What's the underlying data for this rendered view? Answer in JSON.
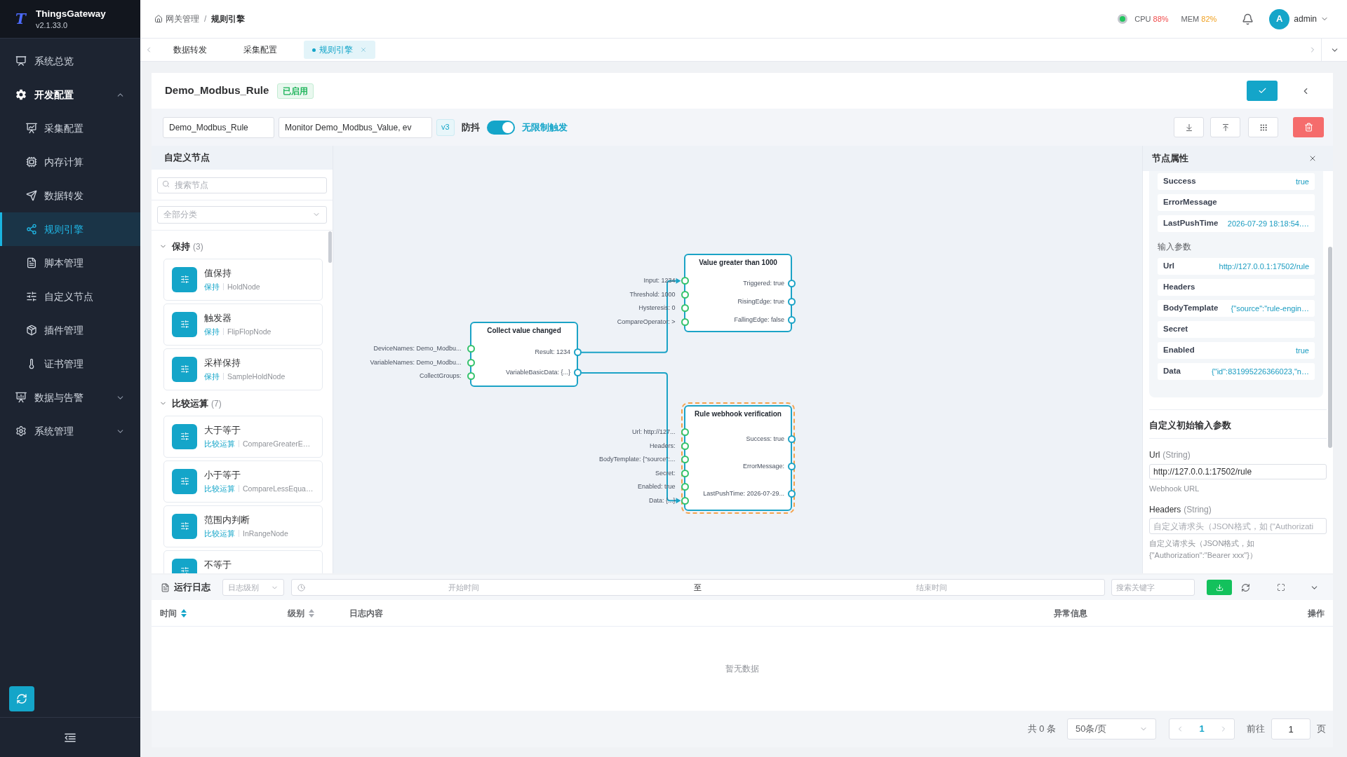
{
  "app": {
    "logo": "T",
    "name": "ThingsGateway",
    "version": "v2.1.33.0"
  },
  "sidebar": {
    "items": [
      {
        "label": "系统总览",
        "selected": false
      },
      {
        "label": "开发配置",
        "selected": false,
        "expanded": true,
        "children": [
          {
            "label": "采集配置",
            "selected": false
          },
          {
            "label": "内存计算",
            "selected": false
          },
          {
            "label": "数据转发",
            "selected": false
          },
          {
            "label": "规则引擎",
            "selected": true
          },
          {
            "label": "脚本管理",
            "selected": false
          },
          {
            "label": "自定义节点",
            "selected": false
          },
          {
            "label": "插件管理",
            "selected": false
          },
          {
            "label": "证书管理",
            "selected": false
          }
        ]
      },
      {
        "label": "数据与告警",
        "selected": false,
        "expanded": false
      },
      {
        "label": "系统管理",
        "selected": false,
        "expanded": false
      }
    ]
  },
  "header": {
    "breadcrumb": {
      "items": [
        "网关管理",
        "规则引擎"
      ],
      "separator": "/"
    },
    "online": true,
    "metrics": [
      {
        "label": "CPU",
        "value": "88%",
        "color": "#f04b4b"
      },
      {
        "label": "MEM",
        "value": "82%",
        "color": "#f0a020"
      }
    ],
    "user": {
      "initial": "A",
      "name": "admin"
    }
  },
  "tabs": [
    {
      "label": "数据转发",
      "selected": false
    },
    {
      "label": "采集配置",
      "selected": false
    },
    {
      "label": "规则引擎",
      "selected": true
    }
  ],
  "rule": {
    "title": "Demo_Modbus_Rule",
    "status": {
      "label": "已启用",
      "enabled": true
    },
    "name": "Demo_Modbus_Rule",
    "description": "Monitor Demo_Modbus_Value, ev",
    "version": "v3",
    "trigger_switch": {
      "off_label": "防抖",
      "on_label": "无限制触发",
      "on": true
    }
  },
  "node_library": {
    "title": "自定义节点",
    "search": {
      "placeholder": "搜索节点"
    },
    "category": {
      "placeholder": "全部分类"
    },
    "groups": [
      {
        "name": "保持",
        "count": "(3)",
        "expanded": true,
        "children": [
          {
            "title": "值保持",
            "category": "保持",
            "type": "HoldNode"
          },
          {
            "title": "触发器",
            "category": "保持",
            "type": "FlipFlopNode"
          },
          {
            "title": "采样保持",
            "category": "保持",
            "type": "SampleHoldNode"
          }
        ]
      },
      {
        "name": "比较运算",
        "count": "(7)",
        "expanded": true,
        "children": [
          {
            "title": "大于等于",
            "category": "比较运算",
            "type": "CompareGreaterE…"
          },
          {
            "title": "小于等于",
            "category": "比较运算",
            "type": "CompareLessEqua…"
          },
          {
            "title": "范围内判断",
            "category": "比较运算",
            "type": "InRangeNode"
          },
          {
            "title": "不等于"
          }
        ]
      }
    ]
  },
  "canvas": {
    "nodes": [
      {
        "title": "Collect value changed",
        "selected": false,
        "inputs": [
          "DeviceNames: Demo_Modbu...",
          "VariableNames: Demo_Modbu...",
          "CollectGroups:"
        ],
        "outputs": [
          "Result: 1234",
          "VariableBasicData: {...}"
        ]
      },
      {
        "title": "Value greater than 1000",
        "selected": false,
        "inputs": [
          "Input: 1234",
          "Threshold: 1000",
          "Hysteresis: 0",
          "CompareOperator: >"
        ],
        "outputs": [
          "Triggered: true",
          "RisingEdge: true",
          "FallingEdge: false"
        ]
      },
      {
        "title": "Rule webhook verification",
        "selected": true,
        "inputs": [
          "Url: http://127...",
          "Headers:",
          "BodyTemplate: {\"source\":...",
          "Secret:",
          "Enabled: true",
          "Data: {...}"
        ],
        "outputs": [
          "Success: true",
          "ErrorMessage:",
          "LastPushTime: 2026-07-29..."
        ]
      }
    ]
  },
  "properties": {
    "title": "节点属性",
    "outputs": [
      {
        "name": "Success",
        "value": "true"
      },
      {
        "name": "ErrorMessage"
      },
      {
        "name": "LastPushTime",
        "value": "2026-07-29 18:18:54.…"
      }
    ],
    "inputs_title": "输入参数",
    "inputs": [
      {
        "name": "Url",
        "value": "http://127.0.0.1:17502/rule"
      },
      {
        "name": "Headers"
      },
      {
        "name": "BodyTemplate",
        "value": "{\"source\":\"rule-engin…"
      },
      {
        "name": "Secret"
      },
      {
        "name": "Enabled",
        "value": "true"
      },
      {
        "name": "Data",
        "value": "{\"id\":831995226366023,\"n…"
      }
    ],
    "custom_title": "自定义初始输入参数",
    "custom_fields": [
      {
        "name": "Url",
        "type": "(String)",
        "value": "http://127.0.0.1:17502/rule",
        "hint": "Webhook URL"
      },
      {
        "name": "Headers",
        "type": "(String)",
        "placeholder": "自定义请求头（JSON格式，如 {\"Authorizati",
        "hint": "自定义请求头（JSON格式，如 {\"Authorization\":\"Bearer xxx\"}）"
      }
    ]
  },
  "log": {
    "title": "运行日志",
    "level": {
      "placeholder": "日志级别"
    },
    "date_range": {
      "start_placeholder": "开始时间",
      "separator": "至",
      "end_placeholder": "结束时间"
    },
    "search": {
      "placeholder": "搜索关键字"
    },
    "columns": [
      {
        "label": "时间",
        "sorted": true
      },
      {
        "label": "级别",
        "sorted": false
      },
      {
        "label": "日志内容"
      },
      {
        "label": "异常信息"
      },
      {
        "label": "操作"
      }
    ],
    "empty_text": "暂无数据",
    "pagination": {
      "total": "共 0 条",
      "page_size": "50条/页",
      "current_page": "1",
      "goto_label": "前往",
      "goto_value": "1",
      "page_label": "页"
    }
  }
}
